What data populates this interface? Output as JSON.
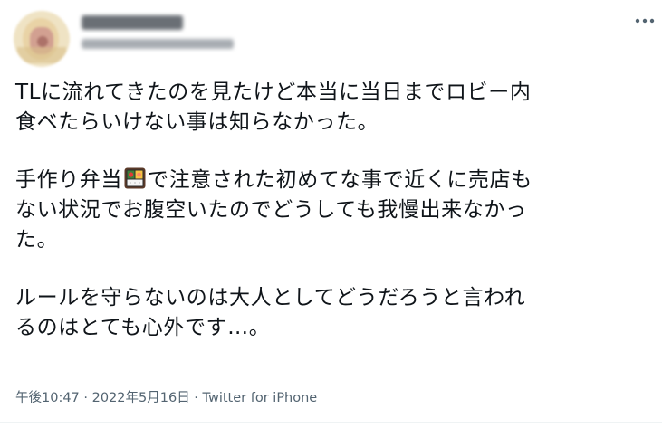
{
  "author": {
    "avatar_icon": "profile-avatar",
    "display_name_blurred": true,
    "handle_blurred": true
  },
  "more_icon": "more-horizontal-icon",
  "tweet": {
    "line_1": "TLに流れてきたのを見たけど本当に当日までロビー内",
    "line_2": "食べたらいけない事は知らなかった。",
    "line_3_before_emoji": "手作り弁当",
    "emoji_icon": "bento-box-icon",
    "line_3_after_emoji": "で注意された初めてな事で近くに売店も",
    "line_4": "ない状況でお腹空いたのでどうしても我慢出来なかっ",
    "line_5": "た。",
    "line_6": "ルールを守らないのは大人としてどうだろうと言われ",
    "line_7": "るのはとても心外です…。"
  },
  "meta": {
    "time": "午後10:47",
    "separator_1": " · ",
    "date": "2022年5月16日",
    "separator_2": " · ",
    "source": "Twitter for iPhone"
  },
  "colors": {
    "text": "#0f1419",
    "meta": "#536471",
    "divider": "#eff3f4"
  }
}
